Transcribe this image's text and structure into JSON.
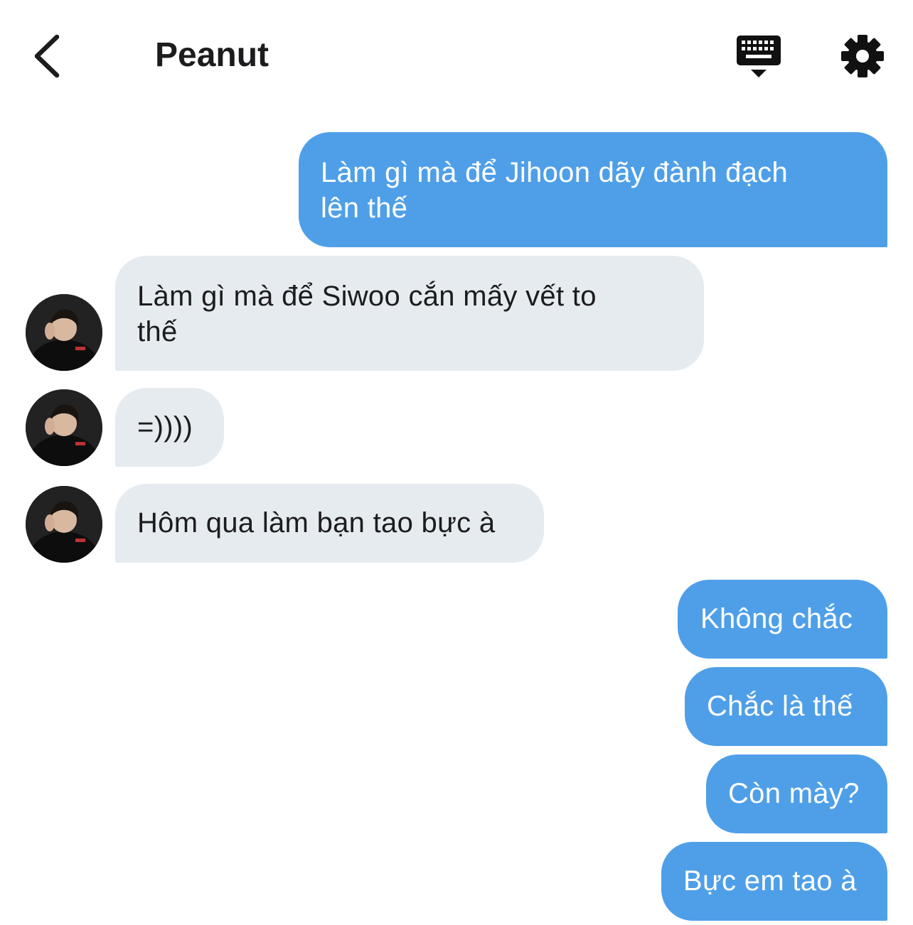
{
  "header": {
    "title": "Peanut",
    "back_icon": "chevron-left-icon",
    "keyboard_icon": "keyboard-hide-icon",
    "settings_icon": "gear-icon"
  },
  "colors": {
    "outgoing_bubble": "#4f9fe8",
    "incoming_bubble": "#e6ebf0",
    "text_dark": "#1c1c1e"
  },
  "messages": [
    {
      "side": "outgoing",
      "lines": [
        "Làm gì mà để Jihoon dãy đành đạch",
        "lên thế"
      ]
    },
    {
      "side": "incoming",
      "lines": [
        "Làm gì mà để Siwoo cắn mấy vết to",
        "thế"
      ]
    },
    {
      "side": "incoming",
      "lines": [
        "=))))"
      ]
    },
    {
      "side": "incoming",
      "lines": [
        "Hôm qua làm bạn tao bực à"
      ]
    },
    {
      "side": "outgoing",
      "lines": [
        "Không chắc"
      ]
    },
    {
      "side": "outgoing",
      "lines": [
        "Chắc là thế"
      ]
    },
    {
      "side": "outgoing",
      "lines": [
        "Còn mày?"
      ]
    },
    {
      "side": "outgoing",
      "lines": [
        "Bực em tao à"
      ]
    }
  ]
}
